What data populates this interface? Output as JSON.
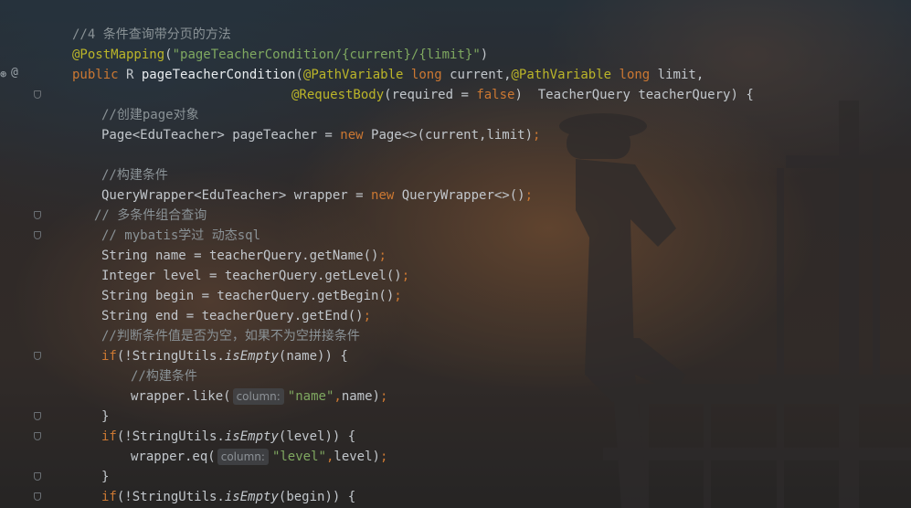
{
  "gutter": {
    "icons": [
      "spring-bean-icon",
      "at-annotation-icon"
    ]
  },
  "code_lines": [
    [
      {
        "t": "//4 条件查询带分页的方法",
        "c": "c-com"
      }
    ],
    [
      {
        "t": "@PostMapping",
        "c": "c-ann"
      },
      {
        "t": "(",
        "c": ""
      },
      {
        "t": "\"pageTeacherCondition/{current}/{limit}\"",
        "c": "c-str"
      },
      {
        "t": ")",
        "c": ""
      }
    ],
    [
      {
        "t": "public ",
        "c": "c-kw"
      },
      {
        "t": "R ",
        "c": ""
      },
      {
        "t": "pageTeacherCondition",
        "c": "c-fn"
      },
      {
        "t": "(",
        "c": ""
      },
      {
        "t": "@PathVariable ",
        "c": "c-ann"
      },
      {
        "t": "long ",
        "c": "c-kw"
      },
      {
        "t": "current,",
        "c": ""
      },
      {
        "t": "@PathVariable ",
        "c": "c-ann"
      },
      {
        "t": "long ",
        "c": "c-kw"
      },
      {
        "t": "limit,",
        "c": ""
      }
    ],
    [
      {
        "t": "@RequestBody",
        "c": "c-ann"
      },
      {
        "t": "(required = ",
        "c": ""
      },
      {
        "t": "false",
        "c": "c-kw"
      },
      {
        "t": ")  TeacherQuery teacherQuery) {",
        "c": ""
      }
    ],
    [
      {
        "t": "//创建page对象",
        "c": "c-com"
      }
    ],
    [
      {
        "t": "Page<EduTeacher> pageTeacher = ",
        "c": ""
      },
      {
        "t": "new ",
        "c": "c-kw"
      },
      {
        "t": "Page<>(current,limit)",
        "c": ""
      },
      {
        "t": ";",
        "c": "c-kw"
      }
    ],
    [],
    [
      {
        "t": "//构建条件",
        "c": "c-com"
      }
    ],
    [
      {
        "t": "QueryWrapper<EduTeacher> wrapper = ",
        "c": ""
      },
      {
        "t": "new ",
        "c": "c-kw"
      },
      {
        "t": "QueryWrapper<>()",
        "c": ""
      },
      {
        "t": ";",
        "c": "c-kw"
      }
    ],
    [
      {
        "t": "// 多条件组合查询",
        "c": "c-com"
      }
    ],
    [
      {
        "t": "// mybatis学过 动态sql",
        "c": "c-com"
      }
    ],
    [
      {
        "t": "String name = teacherQuery.getName()",
        "c": ""
      },
      {
        "t": ";",
        "c": "c-kw"
      }
    ],
    [
      {
        "t": "Integer level = teacherQuery.getLevel()",
        "c": ""
      },
      {
        "t": ";",
        "c": "c-kw"
      }
    ],
    [
      {
        "t": "String begin = teacherQuery.getBegin()",
        "c": ""
      },
      {
        "t": ";",
        "c": "c-kw"
      }
    ],
    [
      {
        "t": "String end = teacherQuery.getEnd()",
        "c": ""
      },
      {
        "t": ";",
        "c": "c-kw"
      }
    ],
    [
      {
        "t": "//判断条件值是否为空，如果不为空拼接条件",
        "c": "c-com"
      }
    ],
    [
      {
        "t": "if",
        "c": "c-kw"
      },
      {
        "t": "(!StringUtils.",
        "c": ""
      },
      {
        "t": "isEmpty",
        "c": "c-it"
      },
      {
        "t": "(name)) {",
        "c": ""
      }
    ],
    [
      {
        "t": "//构建条件",
        "c": "c-com"
      }
    ],
    [
      {
        "t": "wrapper.like(",
        "c": ""
      },
      {
        "hint": "column:"
      },
      {
        "t": "\"name\"",
        "c": "c-str"
      },
      {
        "t": ",",
        "c": "c-kw"
      },
      {
        "t": "name)",
        "c": ""
      },
      {
        "t": ";",
        "c": "c-kw"
      }
    ],
    [
      {
        "t": "}",
        "c": ""
      }
    ],
    [
      {
        "t": "if",
        "c": "c-kw"
      },
      {
        "t": "(!StringUtils.",
        "c": ""
      },
      {
        "t": "isEmpty",
        "c": "c-it"
      },
      {
        "t": "(level)) {",
        "c": ""
      }
    ],
    [
      {
        "t": "wrapper.eq(",
        "c": ""
      },
      {
        "hint": "column:"
      },
      {
        "t": "\"level\"",
        "c": "c-str"
      },
      {
        "t": ",",
        "c": "c-kw"
      },
      {
        "t": "level)",
        "c": ""
      },
      {
        "t": ";",
        "c": "c-kw"
      }
    ],
    [
      {
        "t": "}",
        "c": ""
      }
    ],
    [
      {
        "t": "if",
        "c": "c-kw"
      },
      {
        "t": "(!StringUtils.",
        "c": ""
      },
      {
        "t": "isEmpty",
        "c": "c-it"
      },
      {
        "t": "(begin)) {",
        "c": ""
      }
    ]
  ]
}
